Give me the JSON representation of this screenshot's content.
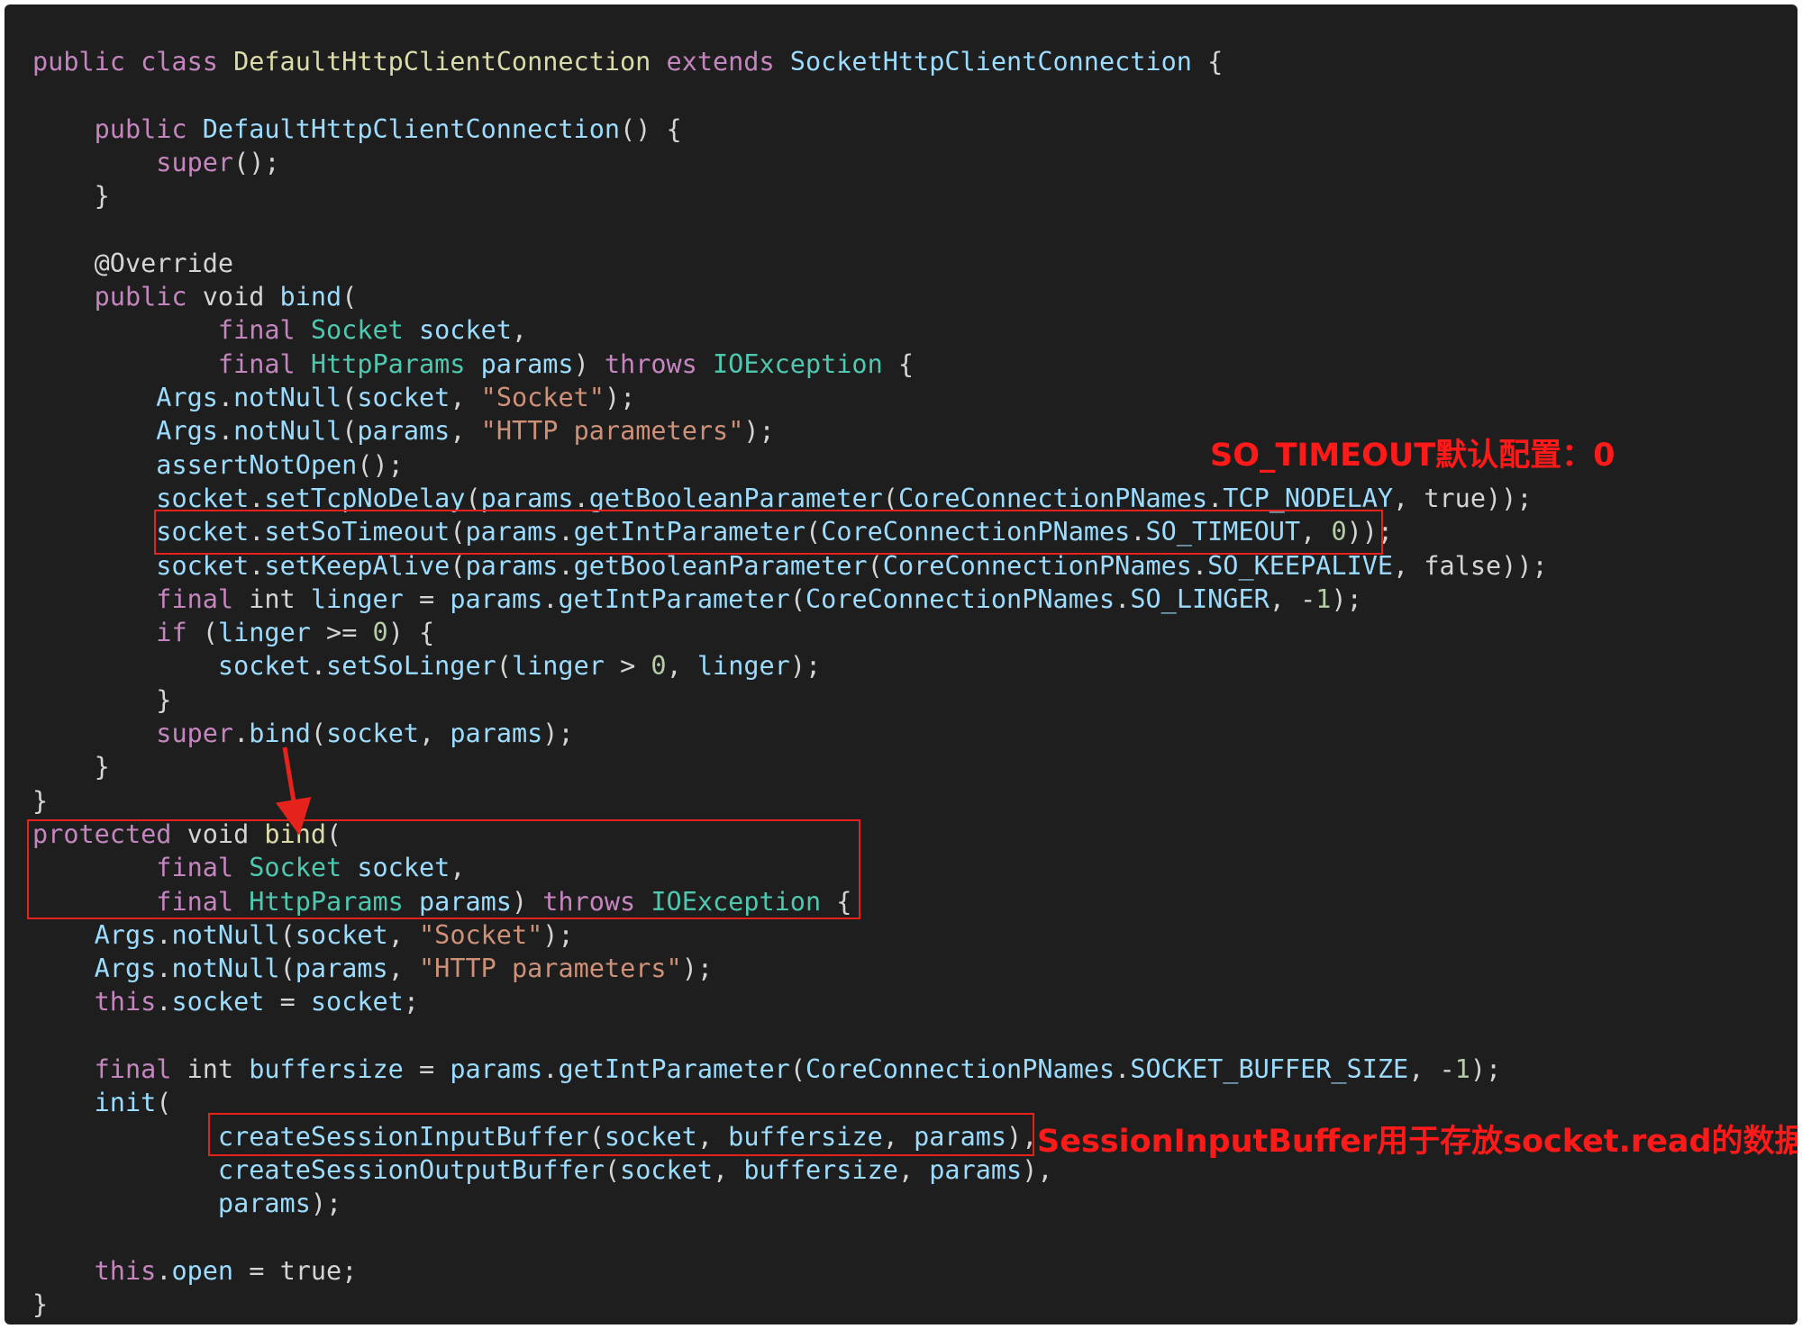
{
  "code_lines": [
    [
      {
        "t": "kw",
        "v": "public class "
      },
      {
        "t": "cls",
        "v": "DefaultHttpClientConnection "
      },
      {
        "t": "kw",
        "v": "extends "
      },
      {
        "t": "fn",
        "v": "SocketHttpClientConnection"
      },
      {
        "t": "pl",
        "v": " {"
      }
    ],
    [],
    [
      {
        "t": "pl",
        "v": "    "
      },
      {
        "t": "kw",
        "v": "public "
      },
      {
        "t": "fn",
        "v": "DefaultHttpClientConnection"
      },
      {
        "t": "pl",
        "v": "() {"
      }
    ],
    [
      {
        "t": "pl",
        "v": "        "
      },
      {
        "t": "kw",
        "v": "super"
      },
      {
        "t": "pl",
        "v": "();"
      }
    ],
    [
      {
        "t": "pl",
        "v": "    }"
      }
    ],
    [],
    [
      {
        "t": "pl",
        "v": "    "
      },
      {
        "t": "ann",
        "v": "@Override"
      }
    ],
    [
      {
        "t": "pl",
        "v": "    "
      },
      {
        "t": "kw",
        "v": "public "
      },
      {
        "t": "pl",
        "v": "void "
      },
      {
        "t": "fn",
        "v": "bind"
      },
      {
        "t": "pl",
        "v": "("
      }
    ],
    [
      {
        "t": "pl",
        "v": "            "
      },
      {
        "t": "kw",
        "v": "final "
      },
      {
        "t": "typ",
        "v": "Socket "
      },
      {
        "t": "var",
        "v": "socket"
      },
      {
        "t": "pl",
        "v": ","
      }
    ],
    [
      {
        "t": "pl",
        "v": "            "
      },
      {
        "t": "kw",
        "v": "final "
      },
      {
        "t": "typ",
        "v": "HttpParams "
      },
      {
        "t": "var",
        "v": "params"
      },
      {
        "t": "pl",
        "v": ") "
      },
      {
        "t": "kw",
        "v": "throws "
      },
      {
        "t": "typ",
        "v": "IOException"
      },
      {
        "t": "pl",
        "v": " {"
      }
    ],
    [
      {
        "t": "pl",
        "v": "        "
      },
      {
        "t": "var",
        "v": "Args"
      },
      {
        "t": "pl",
        "v": "."
      },
      {
        "t": "fn",
        "v": "notNull"
      },
      {
        "t": "pl",
        "v": "("
      },
      {
        "t": "var",
        "v": "socket"
      },
      {
        "t": "pl",
        "v": ", "
      },
      {
        "t": "str",
        "v": "\"Socket\""
      },
      {
        "t": "pl",
        "v": ");"
      }
    ],
    [
      {
        "t": "pl",
        "v": "        "
      },
      {
        "t": "var",
        "v": "Args"
      },
      {
        "t": "pl",
        "v": "."
      },
      {
        "t": "fn",
        "v": "notNull"
      },
      {
        "t": "pl",
        "v": "("
      },
      {
        "t": "var",
        "v": "params"
      },
      {
        "t": "pl",
        "v": ", "
      },
      {
        "t": "str",
        "v": "\"HTTP parameters\""
      },
      {
        "t": "pl",
        "v": ");"
      }
    ],
    [
      {
        "t": "pl",
        "v": "        "
      },
      {
        "t": "fn",
        "v": "assertNotOpen"
      },
      {
        "t": "pl",
        "v": "();"
      }
    ],
    [
      {
        "t": "pl",
        "v": "        "
      },
      {
        "t": "var",
        "v": "socket"
      },
      {
        "t": "pl",
        "v": "."
      },
      {
        "t": "fn",
        "v": "setTcpNoDelay"
      },
      {
        "t": "pl",
        "v": "("
      },
      {
        "t": "var",
        "v": "params"
      },
      {
        "t": "pl",
        "v": "."
      },
      {
        "t": "fn",
        "v": "getBooleanParameter"
      },
      {
        "t": "pl",
        "v": "("
      },
      {
        "t": "var",
        "v": "CoreConnectionPNames"
      },
      {
        "t": "pl",
        "v": "."
      },
      {
        "t": "var",
        "v": "TCP_NODELAY"
      },
      {
        "t": "pl",
        "v": ", true));"
      }
    ],
    [
      {
        "t": "pl",
        "v": "        "
      },
      {
        "t": "var",
        "v": "socket"
      },
      {
        "t": "pl",
        "v": "."
      },
      {
        "t": "fn",
        "v": "setSoTimeout"
      },
      {
        "t": "pl",
        "v": "("
      },
      {
        "t": "var",
        "v": "params"
      },
      {
        "t": "pl",
        "v": "."
      },
      {
        "t": "fn",
        "v": "getIntParameter"
      },
      {
        "t": "pl",
        "v": "("
      },
      {
        "t": "var",
        "v": "CoreConnectionPNames"
      },
      {
        "t": "pl",
        "v": "."
      },
      {
        "t": "var",
        "v": "SO_TIMEOUT"
      },
      {
        "t": "pl",
        "v": ", "
      },
      {
        "t": "num",
        "v": "0"
      },
      {
        "t": "pl",
        "v": "));"
      }
    ],
    [
      {
        "t": "pl",
        "v": "        "
      },
      {
        "t": "var",
        "v": "socket"
      },
      {
        "t": "pl",
        "v": "."
      },
      {
        "t": "fn",
        "v": "setKeepAlive"
      },
      {
        "t": "pl",
        "v": "("
      },
      {
        "t": "var",
        "v": "params"
      },
      {
        "t": "pl",
        "v": "."
      },
      {
        "t": "fn",
        "v": "getBooleanParameter"
      },
      {
        "t": "pl",
        "v": "("
      },
      {
        "t": "var",
        "v": "CoreConnectionPNames"
      },
      {
        "t": "pl",
        "v": "."
      },
      {
        "t": "var",
        "v": "SO_KEEPALIVE"
      },
      {
        "t": "pl",
        "v": ", false));"
      }
    ],
    [
      {
        "t": "pl",
        "v": "        "
      },
      {
        "t": "kw",
        "v": "final "
      },
      {
        "t": "pl",
        "v": "int "
      },
      {
        "t": "var",
        "v": "linger"
      },
      {
        "t": "pl",
        "v": " = "
      },
      {
        "t": "var",
        "v": "params"
      },
      {
        "t": "pl",
        "v": "."
      },
      {
        "t": "fn",
        "v": "getIntParameter"
      },
      {
        "t": "pl",
        "v": "("
      },
      {
        "t": "var",
        "v": "CoreConnectionPNames"
      },
      {
        "t": "pl",
        "v": "."
      },
      {
        "t": "var",
        "v": "SO_LINGER"
      },
      {
        "t": "pl",
        "v": ", -"
      },
      {
        "t": "num",
        "v": "1"
      },
      {
        "t": "pl",
        "v": ");"
      }
    ],
    [
      {
        "t": "pl",
        "v": "        "
      },
      {
        "t": "kw",
        "v": "if "
      },
      {
        "t": "pl",
        "v": "("
      },
      {
        "t": "var",
        "v": "linger"
      },
      {
        "t": "pl",
        "v": " >= "
      },
      {
        "t": "num",
        "v": "0"
      },
      {
        "t": "pl",
        "v": ") {"
      }
    ],
    [
      {
        "t": "pl",
        "v": "            "
      },
      {
        "t": "var",
        "v": "socket"
      },
      {
        "t": "pl",
        "v": "."
      },
      {
        "t": "fn",
        "v": "setSoLinger"
      },
      {
        "t": "pl",
        "v": "("
      },
      {
        "t": "var",
        "v": "linger"
      },
      {
        "t": "pl",
        "v": " > "
      },
      {
        "t": "num",
        "v": "0"
      },
      {
        "t": "pl",
        "v": ", "
      },
      {
        "t": "var",
        "v": "linger"
      },
      {
        "t": "pl",
        "v": ");"
      }
    ],
    [
      {
        "t": "pl",
        "v": "        }"
      }
    ],
    [
      {
        "t": "pl",
        "v": "        "
      },
      {
        "t": "kw",
        "v": "super"
      },
      {
        "t": "pl",
        "v": "."
      },
      {
        "t": "fn",
        "v": "bind"
      },
      {
        "t": "pl",
        "v": "("
      },
      {
        "t": "var",
        "v": "socket"
      },
      {
        "t": "pl",
        "v": ", "
      },
      {
        "t": "var",
        "v": "params"
      },
      {
        "t": "pl",
        "v": ");"
      }
    ],
    [
      {
        "t": "pl",
        "v": "    }"
      }
    ],
    [
      {
        "t": "pl",
        "v": "}"
      }
    ],
    [
      {
        "t": "kw",
        "v": "protected "
      },
      {
        "t": "pl",
        "v": "void "
      },
      {
        "t": "cls",
        "v": "bind"
      },
      {
        "t": "pl",
        "v": "("
      }
    ],
    [
      {
        "t": "pl",
        "v": "        "
      },
      {
        "t": "kw",
        "v": "final "
      },
      {
        "t": "typ",
        "v": "Socket "
      },
      {
        "t": "var",
        "v": "socket"
      },
      {
        "t": "pl",
        "v": ","
      }
    ],
    [
      {
        "t": "pl",
        "v": "        "
      },
      {
        "t": "kw",
        "v": "final "
      },
      {
        "t": "typ",
        "v": "HttpParams "
      },
      {
        "t": "var",
        "v": "params"
      },
      {
        "t": "pl",
        "v": ") "
      },
      {
        "t": "kw",
        "v": "throws "
      },
      {
        "t": "typ",
        "v": "IOException"
      },
      {
        "t": "pl",
        "v": " {"
      }
    ],
    [
      {
        "t": "pl",
        "v": "    "
      },
      {
        "t": "var",
        "v": "Args"
      },
      {
        "t": "pl",
        "v": "."
      },
      {
        "t": "fn",
        "v": "notNull"
      },
      {
        "t": "pl",
        "v": "("
      },
      {
        "t": "var",
        "v": "socket"
      },
      {
        "t": "pl",
        "v": ", "
      },
      {
        "t": "str",
        "v": "\"Socket\""
      },
      {
        "t": "pl",
        "v": ");"
      }
    ],
    [
      {
        "t": "pl",
        "v": "    "
      },
      {
        "t": "var",
        "v": "Args"
      },
      {
        "t": "pl",
        "v": "."
      },
      {
        "t": "fn",
        "v": "notNull"
      },
      {
        "t": "pl",
        "v": "("
      },
      {
        "t": "var",
        "v": "params"
      },
      {
        "t": "pl",
        "v": ", "
      },
      {
        "t": "str",
        "v": "\"HTTP parameters\""
      },
      {
        "t": "pl",
        "v": ");"
      }
    ],
    [
      {
        "t": "pl",
        "v": "    "
      },
      {
        "t": "kw",
        "v": "this"
      },
      {
        "t": "pl",
        "v": "."
      },
      {
        "t": "var",
        "v": "socket"
      },
      {
        "t": "pl",
        "v": " = "
      },
      {
        "t": "var",
        "v": "socket"
      },
      {
        "t": "pl",
        "v": ";"
      }
    ],
    [],
    [
      {
        "t": "pl",
        "v": "    "
      },
      {
        "t": "kw",
        "v": "final "
      },
      {
        "t": "pl",
        "v": "int "
      },
      {
        "t": "var",
        "v": "buffersize"
      },
      {
        "t": "pl",
        "v": " = "
      },
      {
        "t": "var",
        "v": "params"
      },
      {
        "t": "pl",
        "v": "."
      },
      {
        "t": "fn",
        "v": "getIntParameter"
      },
      {
        "t": "pl",
        "v": "("
      },
      {
        "t": "var",
        "v": "CoreConnectionPNames"
      },
      {
        "t": "pl",
        "v": "."
      },
      {
        "t": "var",
        "v": "SOCKET_BUFFER_SIZE"
      },
      {
        "t": "pl",
        "v": ", -"
      },
      {
        "t": "num",
        "v": "1"
      },
      {
        "t": "pl",
        "v": ");"
      }
    ],
    [
      {
        "t": "pl",
        "v": "    "
      },
      {
        "t": "fn",
        "v": "init"
      },
      {
        "t": "pl",
        "v": "("
      }
    ],
    [
      {
        "t": "pl",
        "v": "            "
      },
      {
        "t": "fn",
        "v": "createSessionInputBuffer"
      },
      {
        "t": "pl",
        "v": "("
      },
      {
        "t": "var",
        "v": "socket"
      },
      {
        "t": "pl",
        "v": ", "
      },
      {
        "t": "var",
        "v": "buffersize"
      },
      {
        "t": "pl",
        "v": ", "
      },
      {
        "t": "var",
        "v": "params"
      },
      {
        "t": "pl",
        "v": "),"
      }
    ],
    [
      {
        "t": "pl",
        "v": "            "
      },
      {
        "t": "fn",
        "v": "createSessionOutputBuffer"
      },
      {
        "t": "pl",
        "v": "("
      },
      {
        "t": "var",
        "v": "socket"
      },
      {
        "t": "pl",
        "v": ", "
      },
      {
        "t": "var",
        "v": "buffersize"
      },
      {
        "t": "pl",
        "v": ", "
      },
      {
        "t": "var",
        "v": "params"
      },
      {
        "t": "pl",
        "v": "),"
      }
    ],
    [
      {
        "t": "pl",
        "v": "            "
      },
      {
        "t": "var",
        "v": "params"
      },
      {
        "t": "pl",
        "v": ");"
      }
    ],
    [],
    [
      {
        "t": "pl",
        "v": "    "
      },
      {
        "t": "kw",
        "v": "this"
      },
      {
        "t": "pl",
        "v": "."
      },
      {
        "t": "var",
        "v": "open"
      },
      {
        "t": "pl",
        "v": " = true;"
      }
    ],
    [
      {
        "t": "pl",
        "v": "}"
      }
    ]
  ],
  "annotations": {
    "so_timeout_note": "SO_TIMEOUT默认配置：0",
    "session_buffer_note": "SessionInputBuffer用于存放socket.read的数据"
  },
  "colors": {
    "background": "#1e1e1e",
    "highlight_red": "#e5221b",
    "keyword": "#c586c0",
    "type": "#4ec9b0",
    "class_name": "#dcdcaa",
    "identifier": "#9cdcfe",
    "string": "#ce9178",
    "number": "#b5cea8"
  }
}
